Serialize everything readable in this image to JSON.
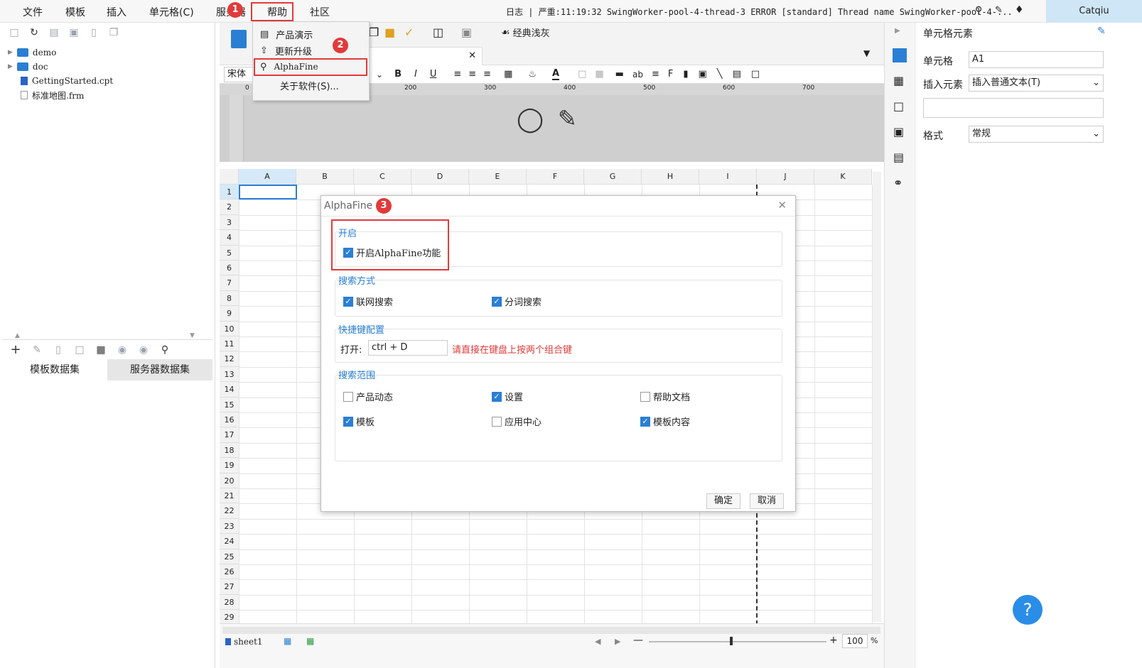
{
  "menubar": {
    "items": [
      "文件",
      "模板",
      "插入",
      "单元格(C)",
      "服务器",
      "帮助",
      "社区"
    ],
    "status_text": "日志 | 严重:11:19:32 SwingWorker-pool-4-thread-3 ERROR [standard] Thread name SwingWorker-pool-4-...",
    "user": "Catqiu"
  },
  "help_menu": {
    "items": [
      "产品演示",
      "更新升级",
      "AlphaFine",
      "关于软件(S)..."
    ]
  },
  "tree": {
    "items": [
      "demo",
      "doc",
      "GettingStarted.cpt",
      "标准地图.frm"
    ]
  },
  "datasets": {
    "tabs": [
      "模板数据集",
      "服务器数据集"
    ]
  },
  "toolbar": {
    "theme_label": "经典浅灰",
    "font_name": "宋体"
  },
  "ruler": {
    "ticks": [
      "0",
      "200",
      "300",
      "400",
      "500",
      "600",
      "700"
    ]
  },
  "grid": {
    "columns": [
      "A",
      "B",
      "C",
      "D",
      "E",
      "F",
      "G",
      "H",
      "I",
      "J",
      "K"
    ],
    "rows": [
      "1",
      "2",
      "3",
      "4",
      "5",
      "6",
      "7",
      "8",
      "9",
      "10",
      "11",
      "12",
      "13",
      "14",
      "15",
      "16",
      "17",
      "18",
      "19",
      "20",
      "21",
      "22",
      "23",
      "24",
      "25",
      "26",
      "27",
      "28",
      "29"
    ]
  },
  "bottom": {
    "sheet": "sheet1",
    "zoom": "100",
    "zoom_unit": "%"
  },
  "right_panel": {
    "title": "单元格元素",
    "cell_label": "单元格",
    "cell_value": "A1",
    "insert_label": "插入元素",
    "insert_value": "插入普通文本(T)",
    "format_label": "格式",
    "format_value": "常规"
  },
  "dialog": {
    "title": "AlphaFine",
    "group_enable": "开启",
    "enable_checkbox": "开启AlphaFine功能",
    "group_search_mode": "搜索方式",
    "online_search": "联网搜索",
    "word_search": "分词搜索",
    "group_shortcut": "快捷键配置",
    "open_label": "打开:",
    "shortcut_value": "ctrl + D",
    "shortcut_hint": "请直接在键盘上按两个组合键",
    "group_scope": "搜索范围",
    "scope_items": [
      {
        "label": "产品动态",
        "checked": false
      },
      {
        "label": "设置",
        "checked": true
      },
      {
        "label": "帮助文档",
        "checked": false
      },
      {
        "label": "模板",
        "checked": true
      },
      {
        "label": "应用中心",
        "checked": false
      },
      {
        "label": "模板内容",
        "checked": true
      }
    ],
    "ok": "确定",
    "cancel": "取消"
  },
  "steps": [
    "1",
    "2",
    "3"
  ],
  "colors": {
    "accent": "#2a7fd4",
    "highlight": "#e23a3a"
  }
}
